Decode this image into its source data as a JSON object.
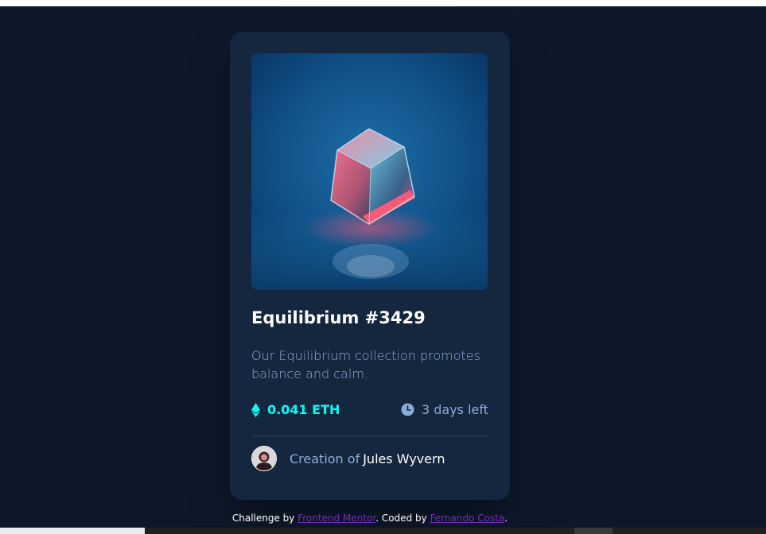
{
  "card": {
    "title": "Equilibrium #3429",
    "description": "Our Equilibrium collection promotes balance and calm.",
    "price": "0.041 ETH",
    "time_left": "3 days left",
    "creator_prefix": "Creation of",
    "creator_name": "Jules Wyvern"
  },
  "footer": {
    "challenge_by": "Challenge by",
    "frontend_mentor_link": "Frontend Mentor",
    "coded_by": ". Coded by",
    "author_link": "Fernando Costa",
    "end": "."
  },
  "icons": {
    "eth": "ethereum-icon",
    "clock": "clock-icon",
    "avatar": "avatar-image",
    "nft": "equilibrium-cube-image"
  },
  "colors": {
    "page_background": "#0d192b",
    "card_background": "#15263f",
    "accent_cyan": "#00fff8",
    "soft_blue": "#8bacd9",
    "white": "#ffffff",
    "link_purple": "#6f2fb6"
  }
}
